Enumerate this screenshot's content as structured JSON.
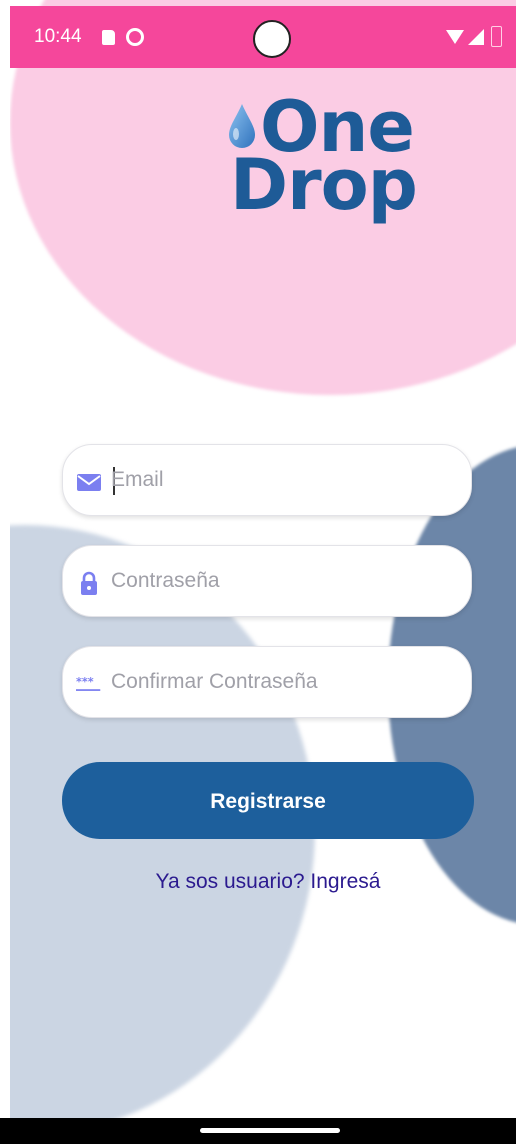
{
  "status_bar": {
    "time": "10:44",
    "icons": [
      "sd-card-icon",
      "sync-icon",
      "wifi-icon",
      "signal-icon",
      "battery-icon"
    ],
    "color": "#f5479b"
  },
  "logo": {
    "line1": "One",
    "line2": "Drop",
    "color": "#1e5b97",
    "drop_color": "#4a90d9"
  },
  "form": {
    "email": {
      "placeholder": "Email",
      "icon": "mail-icon",
      "value": ""
    },
    "password": {
      "placeholder": "Contraseña",
      "icon": "lock-icon",
      "value": ""
    },
    "confirm_password": {
      "placeholder": "Confirmar Contraseña",
      "icon": "password-dots-icon",
      "value": ""
    },
    "icon_color": "#7b7ff0"
  },
  "register_button": {
    "label": "Registrarse",
    "color": "#1d5f9c"
  },
  "login_link": {
    "label": "Ya sos usuario? Ingresá",
    "color": "#2b1a8f"
  },
  "background": {
    "pink": "#fbcce4",
    "navy": "#6c86a8",
    "grey": "#cbd5e3"
  }
}
